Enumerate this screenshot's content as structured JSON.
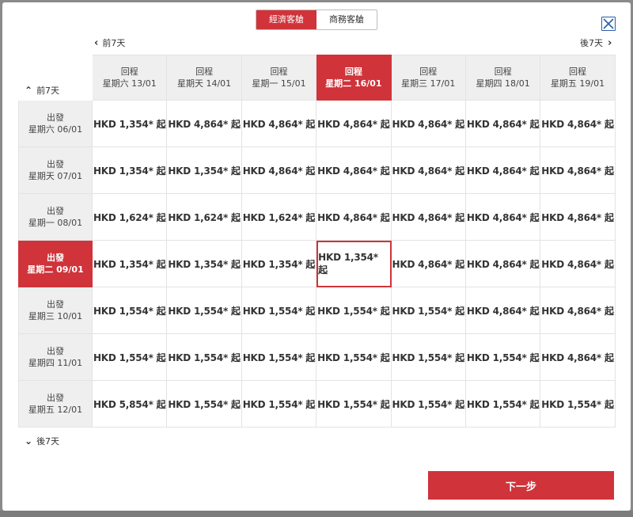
{
  "cabin_tabs": [
    "經濟客艙",
    "商務客艙"
  ],
  "active_cabin": 0,
  "nav": {
    "prev_week_top": "前7天",
    "next_week_top": "後7天",
    "prev_week_left": "前7天",
    "next_week_left": "後7天"
  },
  "return_dates": [
    {
      "label": "回程",
      "date": "星期六 13/01"
    },
    {
      "label": "回程",
      "date": "星期天 14/01"
    },
    {
      "label": "回程",
      "date": "星期一 15/01"
    },
    {
      "label": "回程",
      "date": "星期二 16/01"
    },
    {
      "label": "回程",
      "date": "星期三 17/01"
    },
    {
      "label": "回程",
      "date": "星期四 18/01"
    },
    {
      "label": "回程",
      "date": "星期五 19/01"
    }
  ],
  "selected_return": 3,
  "departure_dates": [
    {
      "label": "出發",
      "date": "星期六 06/01"
    },
    {
      "label": "出發",
      "date": "星期天 07/01"
    },
    {
      "label": "出發",
      "date": "星期一 08/01"
    },
    {
      "label": "出發",
      "date": "星期二 09/01"
    },
    {
      "label": "出發",
      "date": "星期三 10/01"
    },
    {
      "label": "出發",
      "date": "星期四 11/01"
    },
    {
      "label": "出發",
      "date": "星期五 12/01"
    }
  ],
  "selected_departure": 3,
  "prices": [
    [
      "HKD 1,354* 起",
      "HKD 4,864* 起",
      "HKD 4,864* 起",
      "HKD 4,864* 起",
      "HKD 4,864* 起",
      "HKD 4,864* 起",
      "HKD 4,864* 起"
    ],
    [
      "HKD 1,354* 起",
      "HKD 1,354* 起",
      "HKD 4,864* 起",
      "HKD 4,864* 起",
      "HKD 4,864* 起",
      "HKD 4,864* 起",
      "HKD 4,864* 起"
    ],
    [
      "HKD 1,624* 起",
      "HKD 1,624* 起",
      "HKD 1,624* 起",
      "HKD 4,864* 起",
      "HKD 4,864* 起",
      "HKD 4,864* 起",
      "HKD 4,864* 起"
    ],
    [
      "HKD 1,354* 起",
      "HKD 1,354* 起",
      "HKD 1,354* 起",
      "HKD 1,354* 起",
      "HKD 4,864* 起",
      "HKD 4,864* 起",
      "HKD 4,864* 起"
    ],
    [
      "HKD 1,554* 起",
      "HKD 1,554* 起",
      "HKD 1,554* 起",
      "HKD 1,554* 起",
      "HKD 1,554* 起",
      "HKD 4,864* 起",
      "HKD 4,864* 起"
    ],
    [
      "HKD 1,554* 起",
      "HKD 1,554* 起",
      "HKD 1,554* 起",
      "HKD 1,554* 起",
      "HKD 1,554* 起",
      "HKD 1,554* 起",
      "HKD 4,864* 起"
    ],
    [
      "HKD 5,854* 起",
      "HKD 1,554* 起",
      "HKD 1,554* 起",
      "HKD 1,554* 起",
      "HKD 1,554* 起",
      "HKD 1,554* 起",
      "HKD 1,554* 起"
    ]
  ],
  "next_button": "下一步",
  "colors": {
    "accent": "#d0333a",
    "header_bg": "#efefef",
    "close_icon": "#2a5ea8"
  }
}
